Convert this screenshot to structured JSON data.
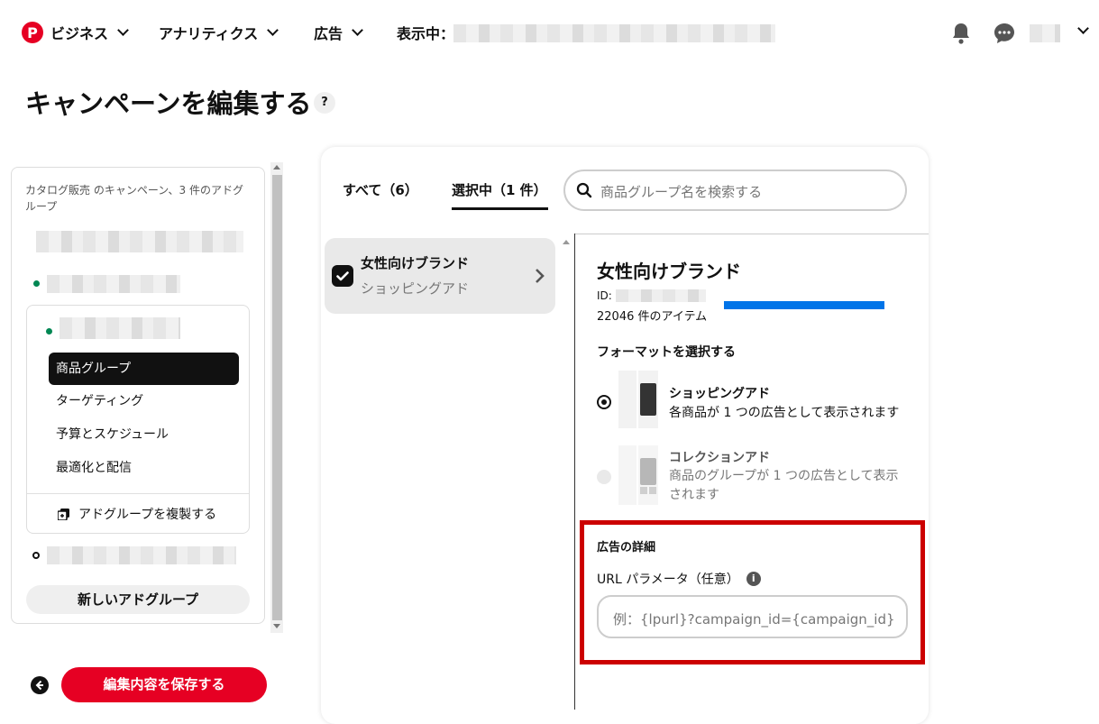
{
  "nav": {
    "business": "ビジネス",
    "analytics": "アナリティクス",
    "ads": "広告",
    "viewing_label": "表示中："
  },
  "page": {
    "title": "キャンペーンを編集する",
    "help": "?"
  },
  "sidebar": {
    "summary": "カタログ販売 のキャンペーン、3 件のアドグループ",
    "menu": [
      "商品グループ",
      "ターゲティング",
      "予算とスケジュール",
      "最適化と配信"
    ],
    "duplicate": "アドグループを複製する",
    "new_adgroup": "新しいアドグループ"
  },
  "footer": {
    "save": "編集内容を保存する"
  },
  "tabs": {
    "all": "すべて（6）",
    "selected": "選択中（1 件）"
  },
  "search": {
    "placeholder": "商品グループ名を検索する"
  },
  "product_list": [
    {
      "title": "女性向けブランド",
      "subtitle": "ショッピングアド"
    }
  ],
  "detail": {
    "title": "女性向けブランド",
    "id_label": "ID: ",
    "items": "22046 件のアイテム",
    "format_heading": "フォーマットを選択する",
    "formats": [
      {
        "title": "ショッピングアド",
        "desc": "各商品が 1 つの広告として表示されます"
      },
      {
        "title": "コレクションアド",
        "desc": "商品のグループが 1 つの広告として表示されます"
      }
    ],
    "ad_details_heading": "広告の詳細",
    "url_param_label": "URL パラメータ（任意）",
    "url_param_placeholder": "例：{lpurl}?campaign_id={campaign_id}"
  },
  "colors": {
    "brand_red": "#e60023",
    "highlight_red": "#cc0000",
    "progress_blue": "#0074e8",
    "dot_green": "#008753"
  }
}
